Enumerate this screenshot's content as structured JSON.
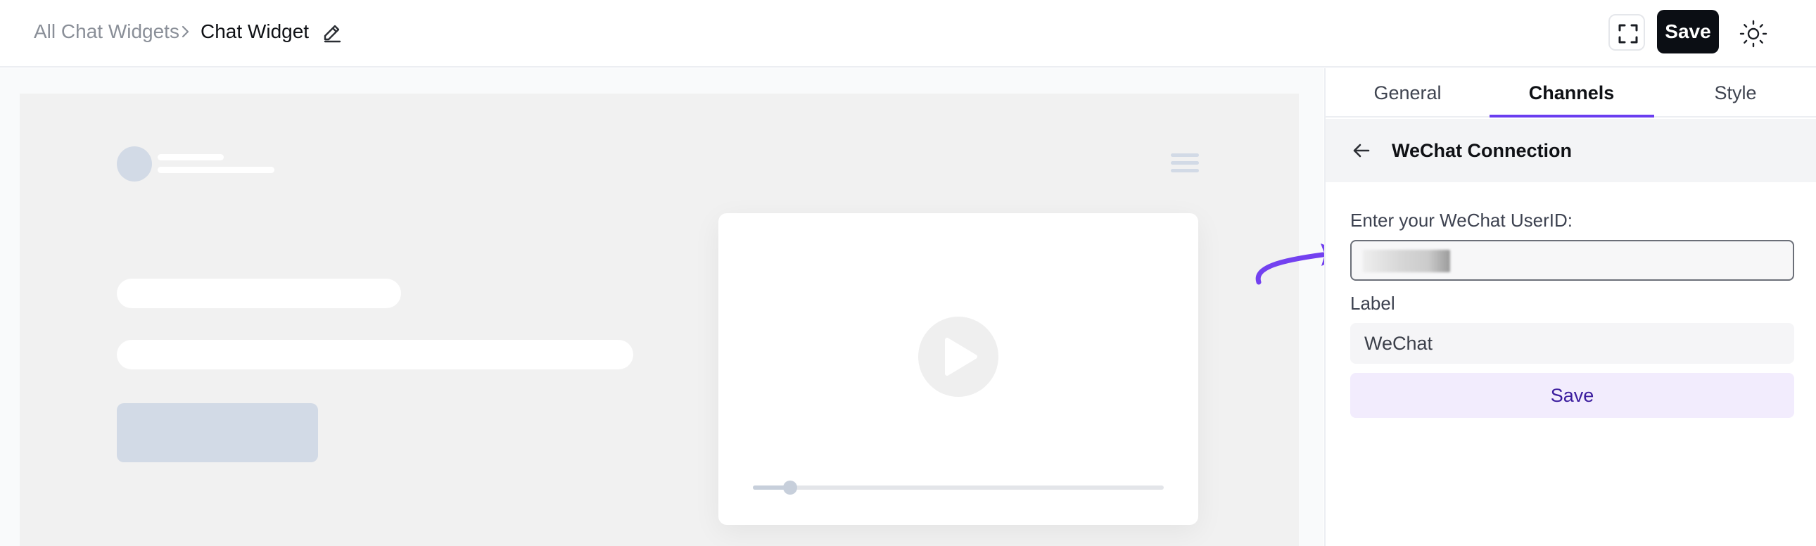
{
  "header": {
    "breadcrumb_parent": "All Chat Widgets",
    "breadcrumb_current": "Chat Widget",
    "save_label": "Save"
  },
  "tabs": [
    {
      "label": "General",
      "active": false
    },
    {
      "label": "Channels",
      "active": true
    },
    {
      "label": "Style",
      "active": false
    }
  ],
  "panel": {
    "title": "WeChat Connection",
    "userid_label": "Enter your WeChat UserID:",
    "userid_value_blurred": true,
    "label_label": "Label",
    "label_value": "WeChat",
    "save_label": "Save"
  },
  "preview": {
    "video_progress": 0.09
  },
  "colors": {
    "accent": "#6a3df0",
    "primary_button": "#0b0e14",
    "secondary_button_bg": "#f2ecfd",
    "secondary_button_text": "#3b1c9e",
    "skeleton": "#d2dae6"
  },
  "icons": [
    "chevron-right-icon",
    "edit-icon",
    "expand-icon",
    "sun-icon",
    "menu-icon",
    "play-icon",
    "arrow-left-icon",
    "curved-arrow-icon"
  ]
}
